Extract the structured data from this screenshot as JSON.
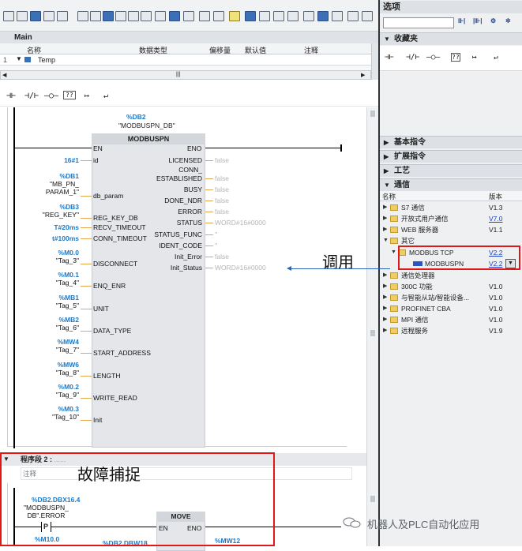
{
  "block": {
    "title": "Main",
    "columns": [
      "名称",
      "数据类型",
      "偏移量",
      "默认值",
      "注释"
    ],
    "row": {
      "index": "1",
      "name": "Temp"
    }
  },
  "ladder_toolbar": [
    "⊣⊢",
    "⊣/⊢",
    "–○–",
    "??",
    "↦",
    "↵"
  ],
  "network1": {
    "db": "%DB2",
    "db_name": "\"MODBUSPN_DB\"",
    "block_name": "MODBUSPN",
    "en": "EN",
    "eno": "ENO",
    "inputs": [
      {
        "addr": "16#1",
        "sym": "",
        "pin": "id"
      },
      {
        "addr": "%DB1",
        "sym": "\"MB_PN_\nPARAM_1\"",
        "pin": "db_param"
      },
      {
        "addr": "%DB3",
        "sym": "\"REG_KEY\"",
        "pin": "REG_KEY_DB"
      },
      {
        "addr": "T#20ms",
        "sym": "",
        "pin": "RECV_TIMEOUT"
      },
      {
        "addr": "t#100ms",
        "sym": "",
        "pin": "CONN_TIMEOUT"
      },
      {
        "addr": "%M0.0",
        "sym": "\"Tag_3\"",
        "pin": "DISCONNECT"
      },
      {
        "addr": "%M0.1",
        "sym": "\"Tag_4\"",
        "pin": "ENQ_ENR"
      },
      {
        "addr": "%MB1",
        "sym": "\"Tag_5\"",
        "pin": "UNIT"
      },
      {
        "addr": "%MB2",
        "sym": "\"Tag_6\"",
        "pin": "DATA_TYPE"
      },
      {
        "addr": "%MW4",
        "sym": "\"Tag_7\"",
        "pin": "START_ADDRESS"
      },
      {
        "addr": "%MW6",
        "sym": "\"Tag_8\"",
        "pin": "LENGTH"
      },
      {
        "addr": "%M0.2",
        "sym": "\"Tag_9\"",
        "pin": "WRITE_READ"
      },
      {
        "addr": "%M0.3",
        "sym": "\"Tag_10\"",
        "pin": "Init"
      }
    ],
    "outputs": [
      {
        "pin": "LICENSED",
        "val": "false"
      },
      {
        "pin": "CONN_\nESTABLISHED",
        "val": "false"
      },
      {
        "pin": "BUSY",
        "val": "false"
      },
      {
        "pin": "DONE_NDR",
        "val": "false"
      },
      {
        "pin": "ERROR",
        "val": "false"
      },
      {
        "pin": "STATUS",
        "val": "WORD#16#0000"
      },
      {
        "pin": "STATUS_FUNC",
        "val": "''"
      },
      {
        "pin": "IDENT_CODE",
        "val": "''"
      },
      {
        "pin": "Init_Error",
        "val": "false"
      },
      {
        "pin": "Init_Status",
        "val": "WORD#16#0000"
      }
    ]
  },
  "network2": {
    "title": "程序段 2 :",
    "title_suffix": "......",
    "comment": "注释",
    "contact_addr": "%DB2.DBX16.4",
    "contact_sym": "\"MODBUSPN_\nDB\".ERROR",
    "contact_type": "P",
    "edge_mem": "%M10.0",
    "move": "MOVE",
    "en": "EN",
    "eno": "ENO",
    "in_addr": "%DB2.DBW18",
    "out_addr": "%MW12"
  },
  "annotations": {
    "call": "调用",
    "catch": "故障捕捉"
  },
  "right_panel": {
    "options_title": "选项",
    "favorites": "收藏夹",
    "basic": "基本指令",
    "extended": "扩展指令",
    "tech": "工艺",
    "comm": "通信",
    "tree_cols": [
      "名称",
      "版本"
    ],
    "tree": [
      {
        "label": "S7 通信",
        "ver": "V1.3",
        "link": false
      },
      {
        "label": "开放式用户通信",
        "ver": "V7.0",
        "link": true
      },
      {
        "label": "WEB 服务器",
        "ver": "V1.1",
        "link": false
      },
      {
        "label": "其它",
        "ver": "",
        "link": false
      },
      {
        "label": "MODBUS TCP",
        "ver": "V2.2",
        "link": true
      },
      {
        "label": "MODBUSPN",
        "ver": "V2.2",
        "link": true
      },
      {
        "label": "通信处理器",
        "ver": "",
        "link": false
      },
      {
        "label": "300C 功能",
        "ver": "V1.0",
        "link": false
      },
      {
        "label": "与智能从站/智能设备...",
        "ver": "V1.0",
        "link": false
      },
      {
        "label": "PROFINET CBA",
        "ver": "V1.0",
        "link": false
      },
      {
        "label": "MPI 通信",
        "ver": "V1.0",
        "link": false
      },
      {
        "label": "远程服务",
        "ver": "V1.9",
        "link": false
      }
    ]
  },
  "watermark": "机器人及PLC自动化应用"
}
